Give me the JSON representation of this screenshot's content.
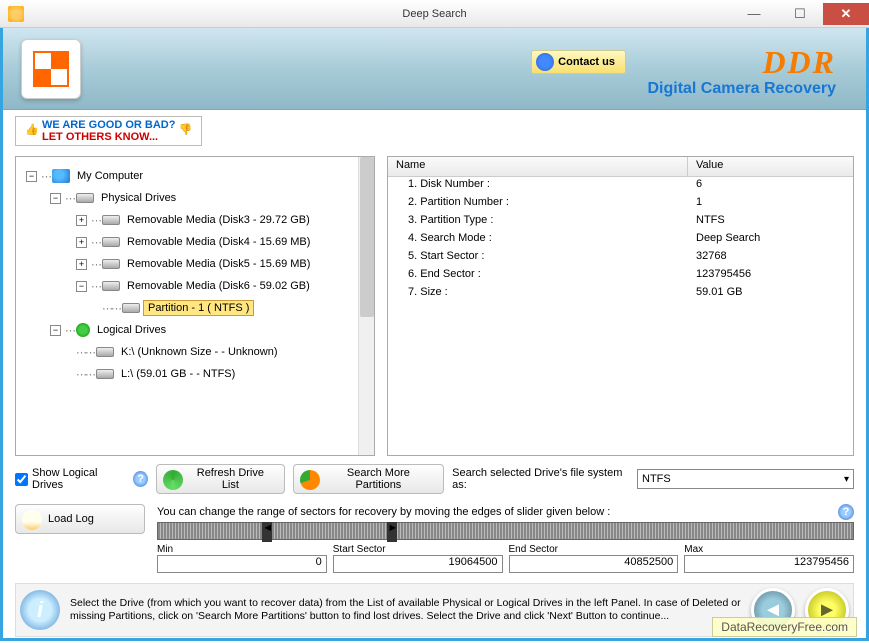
{
  "window": {
    "title": "Deep Search"
  },
  "header": {
    "contact": "Contact us",
    "brand": "DDR",
    "brand_sub": "Digital Camera Recovery"
  },
  "feedback": {
    "line1": "WE ARE GOOD OR BAD?",
    "line2": "LET OTHERS KNOW..."
  },
  "tree": {
    "root": "My Computer",
    "physical": "Physical Drives",
    "drives": [
      "Removable Media (Disk3 - 29.72 GB)",
      "Removable Media (Disk4 - 15.69 MB)",
      "Removable Media (Disk5 - 15.69 MB)",
      "Removable Media (Disk6 - 59.02 GB)"
    ],
    "partition": "Partition - 1 ( NTFS )",
    "logical": "Logical Drives",
    "logical_drives": [
      "K:\\ (Unknown Size  -  - Unknown)",
      "L:\\ (59.01 GB -  - NTFS)"
    ]
  },
  "details": {
    "header_name": "Name",
    "header_value": "Value",
    "rows": [
      {
        "name": "1. Disk Number :",
        "value": "6"
      },
      {
        "name": "2. Partition Number :",
        "value": "1"
      },
      {
        "name": "3. Partition Type :",
        "value": "NTFS"
      },
      {
        "name": "4. Search Mode :",
        "value": "Deep Search"
      },
      {
        "name": "5. Start Sector :",
        "value": "32768"
      },
      {
        "name": "6. End Sector :",
        "value": "123795456"
      },
      {
        "name": "7. Size :",
        "value": "59.01 GB"
      }
    ]
  },
  "controls": {
    "show_logical": "Show Logical Drives",
    "refresh": "Refresh Drive List",
    "search_more": "Search More Partitions",
    "fs_label": "Search selected Drive's file system as:",
    "fs_value": "NTFS",
    "load_log": "Load Log"
  },
  "slider": {
    "hint": "You can change the range of sectors for recovery by moving the edges of slider given below :",
    "min_label": "Min",
    "min": "0",
    "start_label": "Start Sector",
    "start": "19064500",
    "end_label": "End Sector",
    "end": "40852500",
    "max_label": "Max",
    "max": "123795456"
  },
  "footer": {
    "text": "Select the Drive (from which you want to recover data) from the List of available Physical or Logical Drives in the left Panel. In case of Deleted or missing Partitions, click on 'Search More Partitions' button to find lost drives. Select the Drive and click 'Next' Button to continue..."
  },
  "watermark": "DataRecoveryFree.com"
}
